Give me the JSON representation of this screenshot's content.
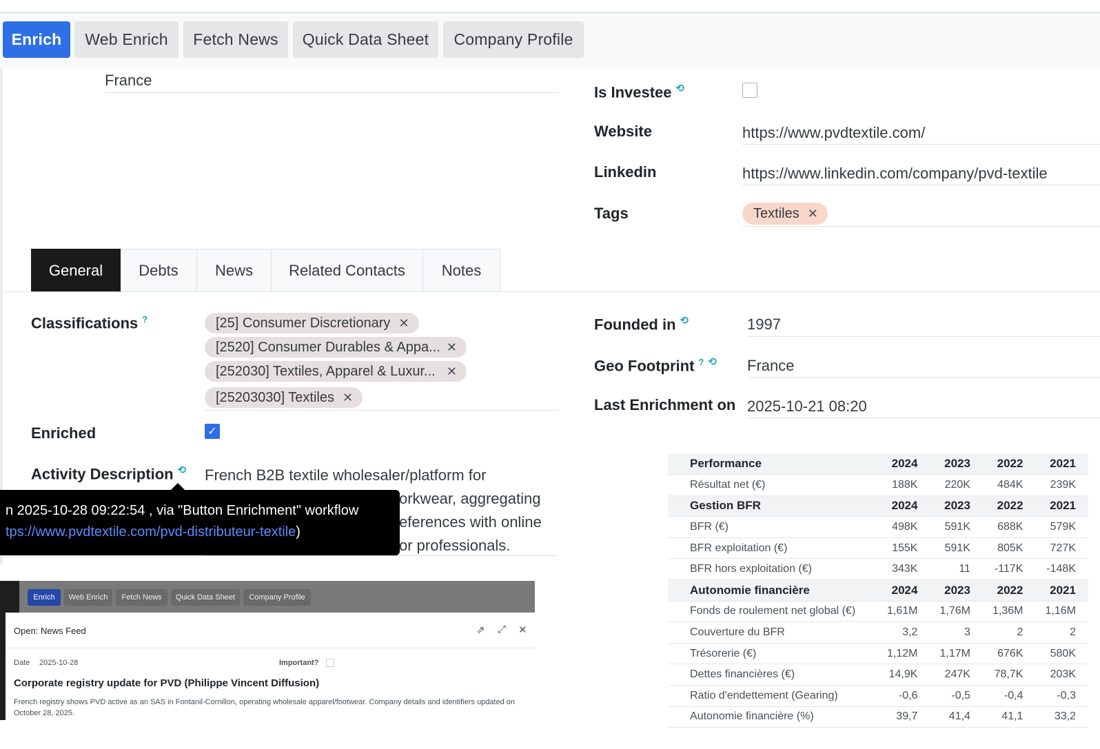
{
  "toolbar": {
    "buttons": [
      {
        "label": "Enrich",
        "primary": true
      },
      {
        "label": "Web Enrich"
      },
      {
        "label": "Fetch News"
      },
      {
        "label": "Quick Data Sheet"
      },
      {
        "label": "Company Profile"
      }
    ]
  },
  "form": {
    "country_value": "France",
    "is_investee_label": "Is Investee",
    "website_label": "Website",
    "website_value": "https://www.pvdtextile.com/",
    "linkedin_label": "Linkedin",
    "linkedin_value": "https://www.linkedin.com/company/pvd-textile",
    "tags_label": "Tags",
    "tags": [
      "Textiles"
    ]
  },
  "tabs": [
    "General",
    "Debts",
    "News",
    "Related Contacts",
    "Notes"
  ],
  "general": {
    "classifications_label": "Classifications",
    "classifications": [
      "[25] Consumer Discretionary",
      "[2520] Consumer Durables & Appa...",
      "[252030] Textiles, Apparel & Luxur...",
      "[25203030] Textiles"
    ],
    "enriched_label": "Enriched",
    "activity_label": "Activity Description",
    "activity_lines": [
      "French B2B textile wholesaler/platform for",
      "orkwear, aggregating",
      "eferences with online",
      "or professionals."
    ],
    "founded_label": "Founded in",
    "founded_value": "1997",
    "geo_label": "Geo Footprint",
    "geo_value": "France",
    "last_enrich_label": "Last Enrichment on",
    "last_enrich_value": "2025-10-21 08:20"
  },
  "tooltip": {
    "line1": "n 2025-10-28 09:22:54 , via \"Button Enrichment\" workflow",
    "link": "tps://www.pvdtextile.com/pvd-distributeur-textile",
    "close": ")"
  },
  "embed": {
    "buttons": [
      "Enrich",
      "Web Enrich",
      "Fetch News",
      "Quick Data Sheet",
      "Company Profile"
    ],
    "title": "Open: News Feed",
    "date_label": "Date",
    "date_value": "2025-10-28",
    "important_label": "Important?",
    "headline": "Corporate registry update for PVD (Philippe Vincent Diffusion)",
    "body": "French registry shows PVD active as an SAS in Fontanil-Cornillon, operating wholesale apparel/footwear. Company details and identifiers updated on October 28, 2025."
  },
  "financials": {
    "rows": [
      {
        "head": true,
        "label": "Performance",
        "values": [
          "2024",
          "2023",
          "2022",
          "2021"
        ]
      },
      {
        "label": "Résultat net (€)",
        "values": [
          "188K",
          "220K",
          "484K",
          "239K"
        ]
      },
      {
        "head": true,
        "label": "Gestion BFR",
        "values": [
          "2024",
          "2023",
          "2022",
          "2021"
        ]
      },
      {
        "label": "BFR (€)",
        "values": [
          "498K",
          "591K",
          "688K",
          "579K"
        ]
      },
      {
        "label": "BFR exploitation (€)",
        "values": [
          "155K",
          "591K",
          "805K",
          "727K"
        ]
      },
      {
        "label": "BFR hors exploitation (€)",
        "values": [
          "343K",
          "11",
          "-117K",
          "-148K"
        ]
      },
      {
        "head": true,
        "label": "Autonomie financière",
        "values": [
          "2024",
          "2023",
          "2022",
          "2021"
        ]
      },
      {
        "label": "Fonds de roulement net global (€)",
        "values": [
          "1,61M",
          "1,76M",
          "1,36M",
          "1,16M"
        ]
      },
      {
        "label": "Couverture du BFR",
        "values": [
          "3,2",
          "3",
          "2",
          "2"
        ]
      },
      {
        "label": "Trésorerie (€)",
        "values": [
          "1,12M",
          "1,17M",
          "676K",
          "580K"
        ]
      },
      {
        "label": "Dettes financières (€)",
        "values": [
          "14,9K",
          "247K",
          "78,7K",
          "203K"
        ]
      },
      {
        "label": "Ratio d'endettement (Gearing)",
        "values": [
          "-0,6",
          "-0,5",
          "-0,4",
          "-0,3"
        ]
      },
      {
        "label": "Autonomie financière (%)",
        "values": [
          "39,7",
          "41,4",
          "41,1",
          "33,2"
        ]
      }
    ]
  }
}
